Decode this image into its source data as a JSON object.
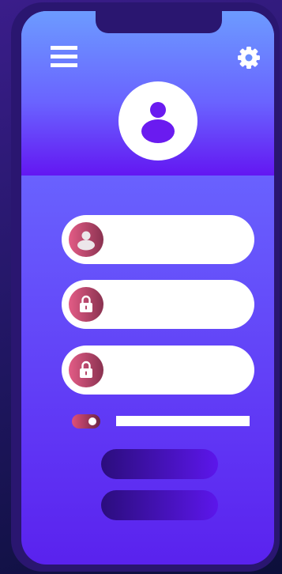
{
  "header": {
    "menu_icon": "hamburger-menu-icon",
    "settings_icon": "gear-icon",
    "avatar_icon": "user-avatar-icon"
  },
  "form": {
    "fields": [
      {
        "icon": "user-icon",
        "value": "",
        "placeholder": ""
      },
      {
        "icon": "lock-icon",
        "value": "",
        "placeholder": ""
      },
      {
        "icon": "lock-icon",
        "value": "",
        "placeholder": ""
      }
    ],
    "toggle": {
      "state": "on",
      "label": ""
    },
    "buttons": [
      {
        "label": ""
      },
      {
        "label": ""
      }
    ]
  },
  "colors": {
    "accent_pink": "#e35c86",
    "accent_purple": "#5c16eb",
    "header_top": "#6c9bff",
    "header_bottom": "#6317f2",
    "phone_frame": "#2a1670"
  }
}
